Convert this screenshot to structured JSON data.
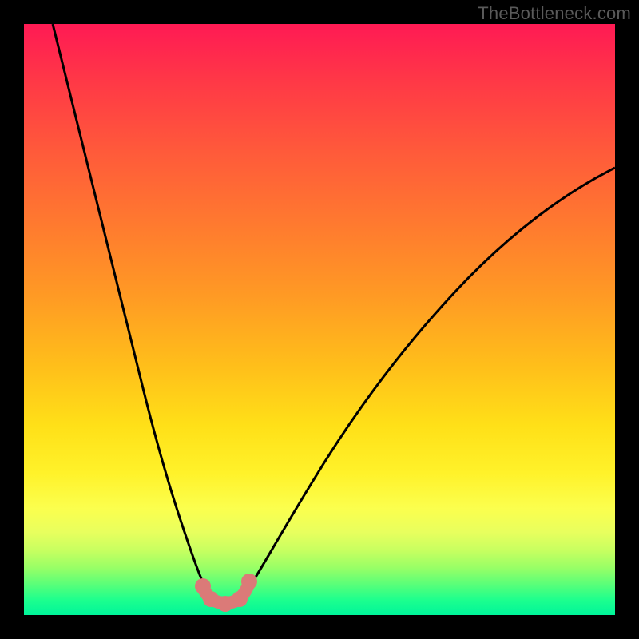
{
  "watermark": "TheBottleneck.com",
  "colors": {
    "page_bg": "#000000",
    "gradient_top": "#ff1a54",
    "gradient_bottom": "#00f59a",
    "curve": "#000000",
    "marker": "#db7a78"
  },
  "chart_data": {
    "type": "line",
    "title": "",
    "xlabel": "",
    "ylabel": "",
    "xlim": [
      0,
      100
    ],
    "ylim": [
      0,
      100
    ],
    "grid": false,
    "legend": false,
    "notes": "Bottleneck-style V chart. x is relative horizontal position (0–100 across the colored plot area). y is bottleneck percentage: 0 = optimal (bottom, green), 100 = severe (top, red). Two monotone curves meet at a flat trough around x≈31–37. Salmon markers sit on the trough.",
    "series": [
      {
        "name": "left-curve",
        "x": [
          5,
          10,
          15,
          20,
          23,
          26,
          29,
          31
        ],
        "y": [
          100,
          78,
          56,
          34,
          23,
          14,
          7,
          3
        ]
      },
      {
        "name": "right-curve",
        "x": [
          37,
          40,
          45,
          50,
          55,
          60,
          65,
          70,
          75,
          80,
          85,
          90,
          95,
          100
        ],
        "y": [
          3,
          8,
          17,
          25,
          32,
          39,
          45,
          51,
          56,
          61,
          65,
          69,
          72,
          75
        ]
      }
    ],
    "trough": {
      "x_start": 31,
      "x_end": 37,
      "y": 2
    },
    "markers": [
      {
        "x": 30,
        "y": 5
      },
      {
        "x": 31,
        "y": 3
      },
      {
        "x": 34,
        "y": 2
      },
      {
        "x": 37,
        "y": 3
      },
      {
        "x": 38,
        "y": 6
      }
    ]
  }
}
